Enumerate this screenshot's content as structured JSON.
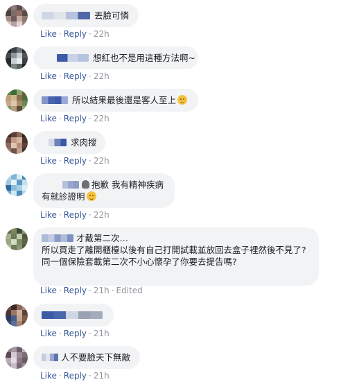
{
  "action_labels": {
    "like": "Like",
    "reply": "Reply",
    "sep": "·"
  },
  "comments": [
    {
      "text": "丟臉可憐",
      "time": "22h",
      "name_blur_colors": [
        "#cfd6e6",
        "#e1e4ea",
        "#b8c2dc",
        "#5066a8"
      ]
    },
    {
      "text": "想紅也不是用這種方法啊~",
      "time": "22h",
      "name_blur_colors": [
        "#3d5aa6",
        "#c9d1e6",
        "#b6c3e0"
      ]
    },
    {
      "text": "所以結果最後還是客人至上",
      "emoji": "pensive-face-emoji",
      "time": "22h",
      "name_blur_colors": [
        "#8496c8",
        "#4764ae",
        "#3f5ba8",
        "#9aaad4"
      ]
    },
    {
      "text": "求肉搜",
      "time": "22h",
      "name_blur_colors": [
        "#d5dae6",
        "#6d81bb",
        "#3a57a5"
      ]
    },
    {
      "line1": "抱歉 我有精神疾病",
      "line2": "有就診證明",
      "emoji": "relieved-face-emoji",
      "hand_icon": "raised-hand-icon",
      "time": "22h",
      "name_blur_colors": [
        "#b5c0dc",
        "#9aa7cc",
        "#8f9cc4"
      ]
    },
    {
      "line1": "才戴第二次…",
      "line2": "所以買走了離開櫃檯以後有自己打開試載並放回去盒子裡然後不見了?",
      "line3": "同一個保險套載第二次不小心懷孕了你要去提告嗎?",
      "time": "21h",
      "edited": "Edited",
      "name_blur_colors": [
        "#aebad8",
        "#c2cbe2",
        "#8c9cc8",
        "#b0bbd8",
        "#7f90c2"
      ]
    },
    {
      "text": "",
      "time": "21h",
      "name_blur_colors": [
        "#3d5aa6",
        "#4a66ad",
        "#d0d6e4",
        "#9aa3b4",
        "#a4acbc"
      ]
    },
    {
      "text": "人不要臉天下無敵",
      "time": "21h",
      "name_blur_colors": [
        "#c4cce0",
        "#e2e5eb",
        "#98a7cf",
        "#5c73b2"
      ]
    }
  ],
  "avatar_colors": [
    [
      "#6b5a58",
      "#8a7a76",
      "#5a4c4a",
      "#a39590",
      "#4d3f3c",
      "#7e6d69",
      "#936f66",
      "#5b4a47",
      "#a48e86",
      "#6f5b57",
      "#c2aaa2",
      "#8e7873",
      "#d6c7c2",
      "#b4a39e",
      "#e0d6d2",
      "#9d8a85"
    ],
    [
      "#1f2426",
      "#3c4244",
      "#6e7476",
      "#2a2f31",
      "#454b4d",
      "#8f9597",
      "#c6cbcd",
      "#505658",
      "#262b2d",
      "#c9cfd2",
      "#e7ecee",
      "#3b4143",
      "#2e3436",
      "#7d8385",
      "#5c6264",
      "#1d2224"
    ],
    [
      "#5b8a4a",
      "#3f6a3a",
      "#8ca66a",
      "#6d5b3f",
      "#b8a07a",
      "#d0b48c",
      "#8a6d4f",
      "#4d6b3c",
      "#c9a98a",
      "#e0c8ae",
      "#a68a6e",
      "#6a8a52",
      "#7a9a64",
      "#b79c80",
      "#5f4a38",
      "#93a87a"
    ],
    [
      "#3b2c26",
      "#5a4038",
      "#8a6656",
      "#2e221e",
      "#6a4c42",
      "#c49a84",
      "#d8b6a2",
      "#4a342c",
      "#8c6a5c",
      "#e2c4b2",
      "#b68c78",
      "#5c4238",
      "#9a7a6c",
      "#6e5448",
      "#c0a090",
      "#3e2e28"
    ],
    [
      "#b7d6e8",
      "#7fb4d4",
      "#d8ecf4",
      "#4a88b8",
      "#9cc8e0",
      "#e6f2f8",
      "#5e9ac4",
      "#c6e0ee",
      "#2f6aa0",
      "#8cbcd8",
      "#a8d0e6",
      "#e0eef6",
      "#6aa6cc",
      "#d2e8f2",
      "#4c8cbc",
      "#b0d4e8"
    ],
    [
      "#5e6a4c",
      "#7a8862",
      "#3e4a34",
      "#8f9c78",
      "#a8b290",
      "#6c7858",
      "#c4ccb0",
      "#4e5a3e",
      "#9aa684",
      "#d4dcc4",
      "#7c8866",
      "#5a6648",
      "#b6c09e",
      "#6e7a5a",
      "#8a9674",
      "#48543a"
    ],
    [
      "#6e4a3e",
      "#3a2a26",
      "#8c6a5a",
      "#b08c78",
      "#4c3632",
      "#9a7664",
      "#d0b09c",
      "#5e4238",
      "#2c3a5e",
      "#4a5c86",
      "#c4a490",
      "#7e5c4c",
      "#394a72",
      "#5c6e96",
      "#a48472",
      "#6a4e42"
    ],
    [
      "#8c7c86",
      "#a694a0",
      "#6e5e6a",
      "#c2b4be",
      "#5a4a56",
      "#d6cad2",
      "#9a8a96",
      "#7c6c78",
      "#b8aab4",
      "#e4dae0",
      "#8a7a86",
      "#6a5a66",
      "#a898a4",
      "#c8bcc4",
      "#786874",
      "#9c8c98"
    ]
  ]
}
